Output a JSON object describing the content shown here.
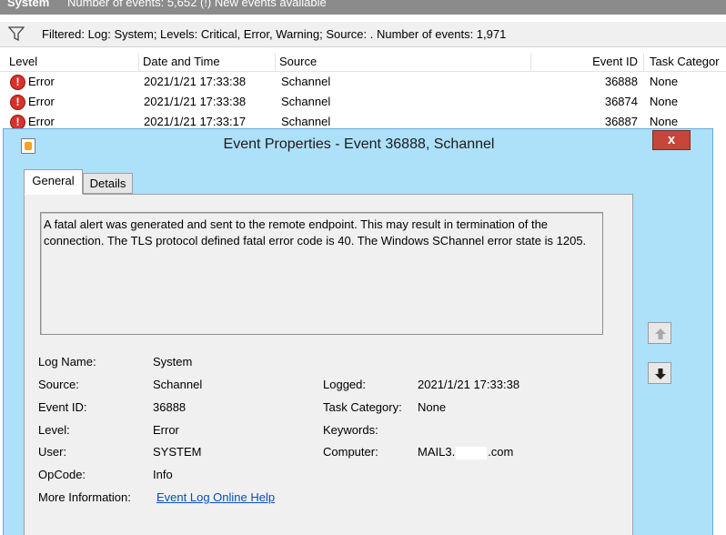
{
  "header": {
    "title": "System",
    "event_count": "Number of events: 5,652 (!) New events available"
  },
  "filter": {
    "text": "Filtered: Log: System; Levels: Critical, Error, Warning; Source: . Number of events: 1,971"
  },
  "columns": [
    "Level",
    "Date and Time",
    "Source",
    "Event ID",
    "Task Categor"
  ],
  "rows": [
    {
      "level": "Error",
      "date": "2021/1/21 17:33:38",
      "source": "Schannel",
      "event_id": "36888",
      "task": "None"
    },
    {
      "level": "Error",
      "date": "2021/1/21 17:33:38",
      "source": "Schannel",
      "event_id": "36874",
      "task": "None"
    },
    {
      "level": "Error",
      "date": "2021/1/21 17:33:17",
      "source": "Schannel",
      "event_id": "36887",
      "task": "None"
    }
  ],
  "dialog": {
    "title": "Event Properties - Event 36888, Schannel",
    "close": "x",
    "tabs": [
      "General",
      "Details"
    ],
    "description": "A fatal alert was generated and sent to the remote endpoint. This may result in termination of the connection. The TLS protocol defined fatal error code is 40. The Windows SChannel error state is 1205.",
    "labels": {
      "log_name": "Log Name:",
      "source": "Source:",
      "event_id": "Event ID:",
      "level": "Level:",
      "user": "User:",
      "opcode": "OpCode:",
      "more_info": "More Information:",
      "logged": "Logged:",
      "task_category": "Task Category:",
      "keywords": "Keywords:",
      "computer": "Computer:"
    },
    "values": {
      "log_name": "System",
      "source": "Schannel",
      "event_id": "36888",
      "level": "Error",
      "user": "SYSTEM",
      "opcode": "Info",
      "more_info": "Event Log Online Help",
      "logged": "2021/1/21 17:33:38",
      "task_category": "None",
      "keywords": "",
      "computer_prefix": "MAIL3.",
      "computer_suffix": ".com"
    }
  },
  "colors": {
    "error": "#d9312a",
    "dialog_frame": "#ade0f9",
    "close": "#c7453a",
    "link": "#0a4db3"
  }
}
